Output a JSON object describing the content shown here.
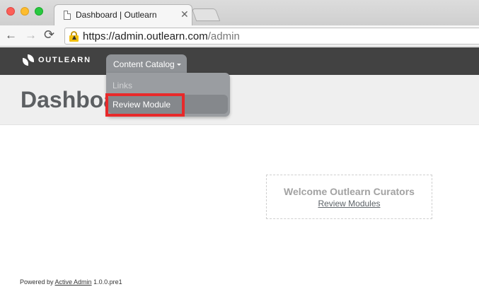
{
  "browser": {
    "tab_title": "Dashboard | Outlearn",
    "tab_close": "✕",
    "url_host": "https://admin.outlearn.com",
    "url_path": "/admin",
    "back_glyph": "←",
    "forward_glyph": "→",
    "reload_glyph": "⟳"
  },
  "header": {
    "logo_text": "OUTLEARN",
    "menu": {
      "label": "Content Catalog",
      "items": [
        "Links",
        "Review Module"
      ],
      "highlighted_item": "Review Module"
    }
  },
  "page": {
    "title": "Dashboard"
  },
  "welcome": {
    "title": "Welcome Outlearn Curators",
    "link": "Review Modules"
  },
  "footer": {
    "prefix": "Powered by ",
    "link": "Active Admin",
    "version": " 1.0.0.pre1"
  },
  "colors": {
    "header_bg": "#424242",
    "menu_bg": "#8f9296",
    "highlight": "#e8292a",
    "title_bg": "#efefef"
  }
}
